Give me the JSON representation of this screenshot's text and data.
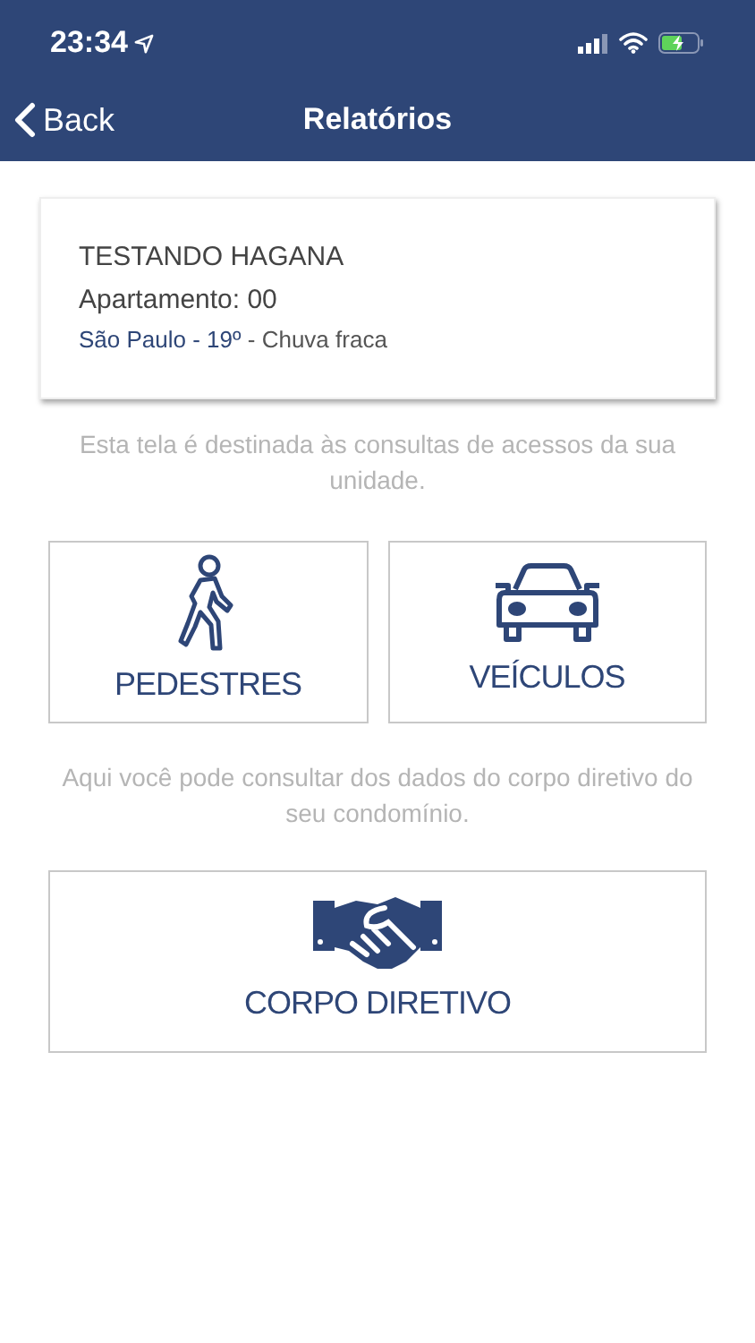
{
  "status_bar": {
    "time": "23:34",
    "battery_charging": true
  },
  "nav": {
    "back": "Back",
    "title": "Relatórios"
  },
  "info_card": {
    "name": "TESTANDO HAGANA",
    "apartment": "Apartamento: 00",
    "city": "São Paulo - 19º",
    "weather": "- Chuva fraca"
  },
  "sections": [
    {
      "description": "Esta tela é destinada às consultas de acessos da sua unidade.",
      "tiles": [
        {
          "kind": "walker",
          "label": "PEDESTRES"
        },
        {
          "kind": "car",
          "label": "VEÍCULOS"
        }
      ]
    },
    {
      "description": "Aqui você pode consultar dos dados do corpo diretivo do seu condomínio.",
      "tiles": [
        {
          "kind": "handshake",
          "label": "CORPO DIRETIVO"
        }
      ]
    }
  ]
}
